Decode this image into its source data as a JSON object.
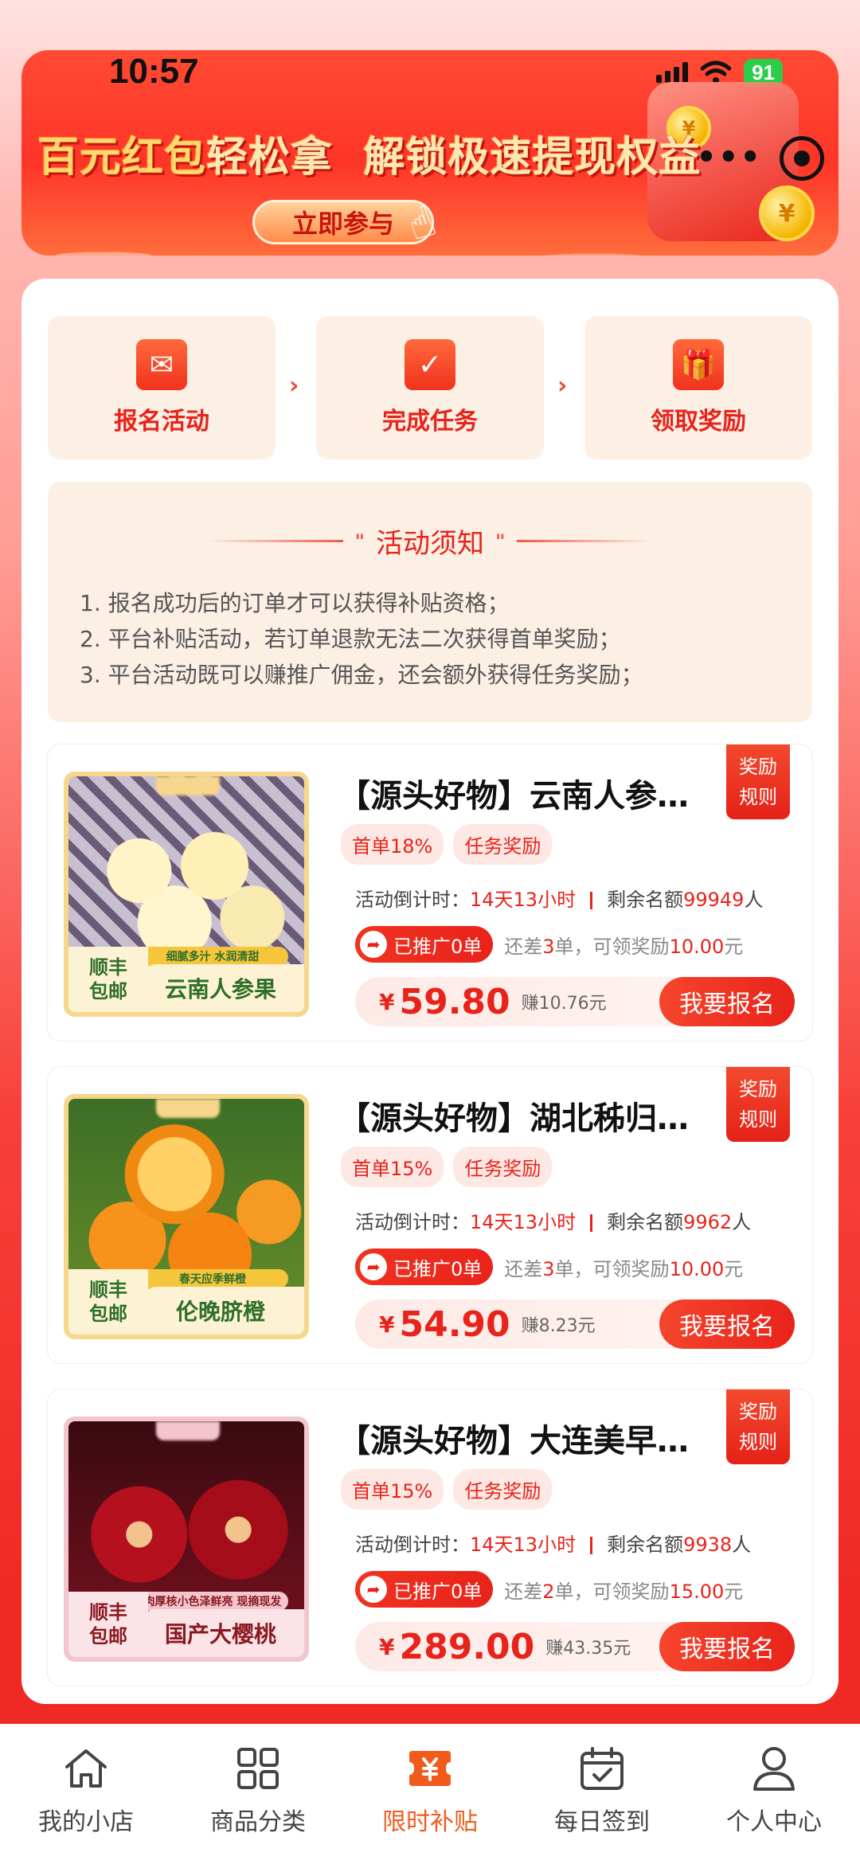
{
  "status": {
    "time": "10:57",
    "battery": "91"
  },
  "banner": {
    "title_part1": "百元红包",
    "title_part2": "轻松拿",
    "title_part3": "解锁极速提现权益",
    "join_button": "立即参与",
    "coin_symbol": "¥",
    "more_label": "•••"
  },
  "steps": [
    {
      "label": "报名活动",
      "icon": "envelope-icon"
    },
    {
      "label": "完成任务",
      "icon": "clipboard-check-icon"
    },
    {
      "label": "领取奖励",
      "icon": "gift-icon"
    }
  ],
  "step_arrow": "›",
  "notice": {
    "title": "活动须知",
    "quote_left": "\"",
    "quote_right": "\"",
    "items": [
      "1. 报名成功后的订单才可以获得补贴资格；",
      "2. 平台补贴活动，若订单退款无法二次获得首单奖励；",
      "3. 平台活动既可以赚推广佣金，还会额外获得任务奖励；"
    ]
  },
  "products": [
    {
      "title": "【源头好物】云南人参…",
      "rule_line1": "奖励",
      "rule_line2": "规则",
      "chip_first": "首单18%",
      "chip_task": "任务奖励",
      "countdown_label": "活动倒计时：",
      "countdown_value": "14天13小时",
      "quota_label": "剩余名额",
      "quota_value": "99949",
      "quota_unit": "人",
      "promoted": "已推广0单",
      "remain_prefix": "还差",
      "remain_count": "3",
      "remain_mid": "单，可领奖励",
      "remain_amount": "10.00",
      "remain_unit": "元",
      "currency": "¥",
      "price": "59.80",
      "earn": "赚10.76元",
      "signup": "我要报名",
      "thumb_ship_1": "顺丰",
      "thumb_ship_2": "包邮",
      "thumb_feature": "细腻多汁 水润清甜",
      "thumb_name": "云南人参果"
    },
    {
      "title": "【源头好物】湖北秭归…",
      "rule_line1": "奖励",
      "rule_line2": "规则",
      "chip_first": "首单15%",
      "chip_task": "任务奖励",
      "countdown_label": "活动倒计时：",
      "countdown_value": "14天13小时",
      "quota_label": "剩余名额",
      "quota_value": "9962",
      "quota_unit": "人",
      "promoted": "已推广0单",
      "remain_prefix": "还差",
      "remain_count": "3",
      "remain_mid": "单，可领奖励",
      "remain_amount": "10.00",
      "remain_unit": "元",
      "currency": "¥",
      "price": "54.90",
      "earn": "赚8.23元",
      "signup": "我要报名",
      "thumb_ship_1": "顺丰",
      "thumb_ship_2": "包邮",
      "thumb_feature": "春天应季鲜橙",
      "thumb_name": "伦晚脐橙"
    },
    {
      "title": "【源头好物】大连美早…",
      "rule_line1": "奖励",
      "rule_line2": "规则",
      "chip_first": "首单15%",
      "chip_task": "任务奖励",
      "countdown_label": "活动倒计时：",
      "countdown_value": "14天13小时",
      "quota_label": "剩余名额",
      "quota_value": "9938",
      "quota_unit": "人",
      "promoted": "已推广0单",
      "remain_prefix": "还差",
      "remain_count": "2",
      "remain_mid": "单，可领奖励",
      "remain_amount": "15.00",
      "remain_unit": "元",
      "currency": "¥",
      "price": "289.00",
      "earn": "赚43.35元",
      "signup": "我要报名",
      "thumb_ship_1": "顺丰",
      "thumb_ship_2": "包邮",
      "thumb_feature": "肉厚核小色泽鲜亮 现摘现发",
      "thumb_name": "国产大樱桃"
    }
  ],
  "tabs": [
    {
      "label": "我的小店",
      "icon": "home-icon"
    },
    {
      "label": "商品分类",
      "icon": "grid-icon"
    },
    {
      "label": "限时补贴",
      "icon": "yen-ticket-icon",
      "active": true
    },
    {
      "label": "每日签到",
      "icon": "calendar-check-icon"
    },
    {
      "label": "个人中心",
      "icon": "user-icon"
    }
  ],
  "colors": {
    "accent": "#e8231b",
    "active_tab": "#f05a1c",
    "step_bg": "#fcefe4"
  }
}
